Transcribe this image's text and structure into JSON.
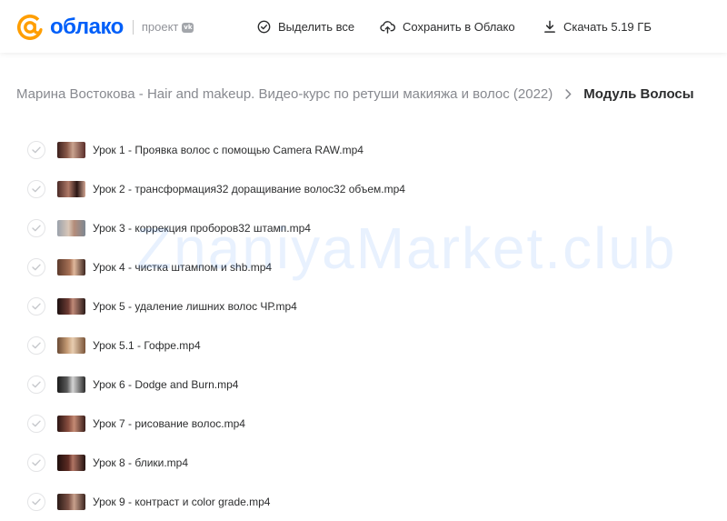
{
  "header": {
    "logo_text": "облако",
    "project_label": "проект",
    "vk_badge": "vk",
    "actions": [
      {
        "label": "Выделить все",
        "icon": "check-circle-icon"
      },
      {
        "label": "Сохранить в Облако",
        "icon": "cloud-upload-icon"
      },
      {
        "label": "Скачать 5.19 ГБ",
        "icon": "download-icon"
      }
    ]
  },
  "breadcrumb": {
    "parent": "Марина Востокова - Hair and makeup. Видео-курс по ретуши макияжа и волос (2022)",
    "current": "Модуль Волосы"
  },
  "files": [
    {
      "name": "Урок 1 - Проявка волос с помощью Camera RAW.mp4"
    },
    {
      "name": "Урок 2 - трансформация32 доращивание волос32 объем.mp4"
    },
    {
      "name": "Урок 3 - коррекция проборов32 штамп.mp4"
    },
    {
      "name": "Урок 4 - чистка штампом и shb.mp4"
    },
    {
      "name": "Урок 5 - удаление лишних волос ЧР.mp4"
    },
    {
      "name": "Урок 5.1 - Гофре.mp4"
    },
    {
      "name": "Урок 6 - Dodge and Burn.mp4"
    },
    {
      "name": "Урок 7 - рисование волос.mp4"
    },
    {
      "name": "Урок 8 - блики.mp4"
    },
    {
      "name": "Урок 9 - контраст и color grade.mp4"
    }
  ],
  "watermark": "ZnaniyaMarket.club",
  "colors": {
    "brand_blue": "#005ff9",
    "brand_orange": "#ff9e00",
    "muted_text": "#87898f"
  }
}
